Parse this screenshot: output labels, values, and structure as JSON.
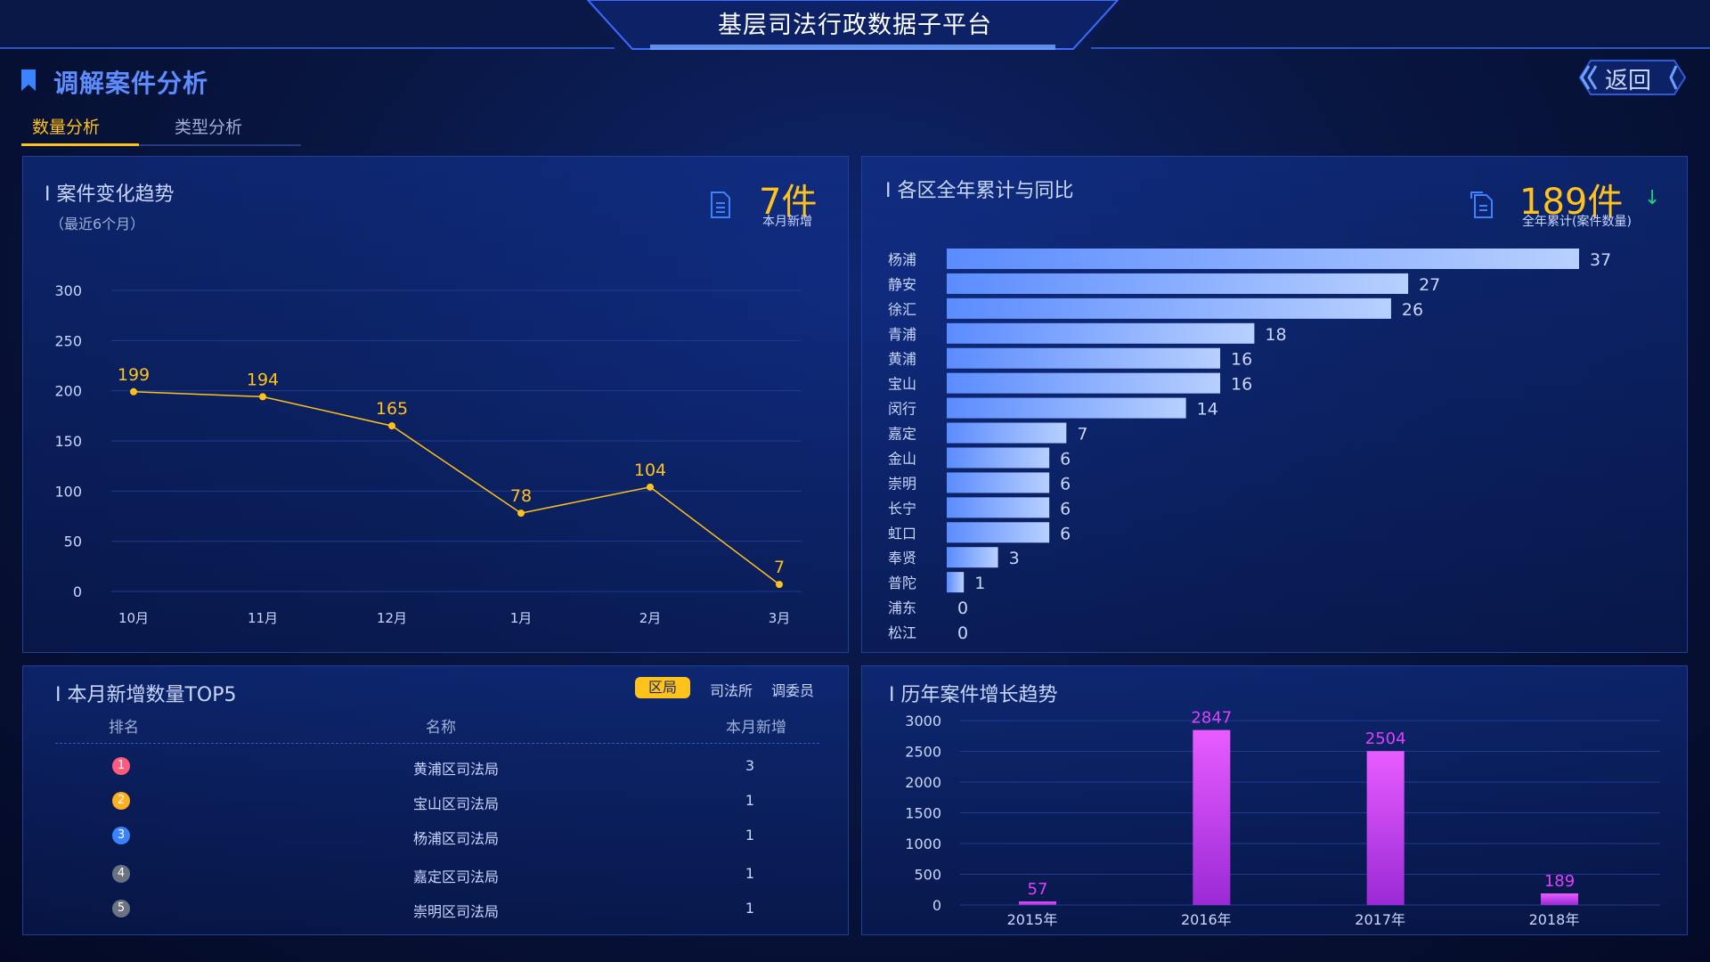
{
  "header": {
    "title": "基层司法行政数据子平台",
    "section_title": "调解案件分析",
    "back_label": "返回"
  },
  "tabs": [
    {
      "label": "数量分析",
      "active": true
    },
    {
      "label": "类型分析",
      "active": false
    }
  ],
  "trend_panel": {
    "title": "I 案件变化趋势",
    "subtitle": "（最近6个月）",
    "kpi_value": "7件",
    "kpi_label": "本月新增"
  },
  "district_panel": {
    "title": "I 各区全年累计与同比",
    "kpi_value": "189件",
    "kpi_label": "全年累计(案件数量)",
    "trend_arrow": "↓"
  },
  "top5_panel": {
    "title": "I 本月新增数量TOP5",
    "filters": [
      "区局",
      "司法所",
      "调委员"
    ],
    "columns": [
      "排名",
      "名称",
      "本月新增"
    ],
    "rows": [
      {
        "rank": "1",
        "name": "黄浦区司法局",
        "value": "3",
        "color": "#ff5a7a"
      },
      {
        "rank": "2",
        "name": "宝山区司法局",
        "value": "1",
        "color": "#ffb021"
      },
      {
        "rank": "3",
        "name": "杨浦区司法局",
        "value": "1",
        "color": "#3b82ff"
      },
      {
        "rank": "4",
        "name": "嘉定区司法局",
        "value": "1",
        "color": "#6b7280"
      },
      {
        "rank": "5",
        "name": "崇明区司法局",
        "value": "1",
        "color": "#6b7280"
      }
    ]
  },
  "history_panel": {
    "title": "I 历年案件增长趋势"
  },
  "colors": {
    "accent": "#ffc21a",
    "line": "#ffc21a",
    "bar_start": "#5b8cff",
    "bar_end": "#b8d0ff",
    "magenta": "#e040fb",
    "grid": "#1f3b8e",
    "text": "#c9d6ff"
  },
  "chart_data": [
    {
      "type": "line",
      "title": "",
      "categories": [
        "10月",
        "11月",
        "12月",
        "1月",
        "2月",
        "3月"
      ],
      "values": [
        199,
        194,
        165,
        78,
        104,
        7
      ],
      "ylim": [
        0,
        300
      ],
      "yticks": [
        0,
        50,
        100,
        150,
        200,
        250,
        300
      ],
      "grid": true
    },
    {
      "type": "bar",
      "orientation": "horizontal",
      "categories": [
        "杨浦",
        "静安",
        "徐汇",
        "青浦",
        "黄浦",
        "宝山",
        "闵行",
        "嘉定",
        "金山",
        "崇明",
        "长宁",
        "虹口",
        "奉贤",
        "普陀",
        "浦东",
        "松江"
      ],
      "values": [
        37,
        27,
        26,
        18,
        16,
        16,
        14,
        7,
        6,
        6,
        6,
        6,
        3,
        1,
        0,
        0
      ],
      "xlim": [
        0,
        37
      ]
    },
    {
      "type": "bar",
      "categories": [
        "2015年",
        "2016年",
        "2017年",
        "2018年"
      ],
      "values": [
        57,
        2847,
        2504,
        189
      ],
      "ylim": [
        0,
        3000
      ],
      "yticks": [
        0,
        500,
        1000,
        1500,
        2000,
        2500,
        3000
      ],
      "grid": true
    }
  ]
}
